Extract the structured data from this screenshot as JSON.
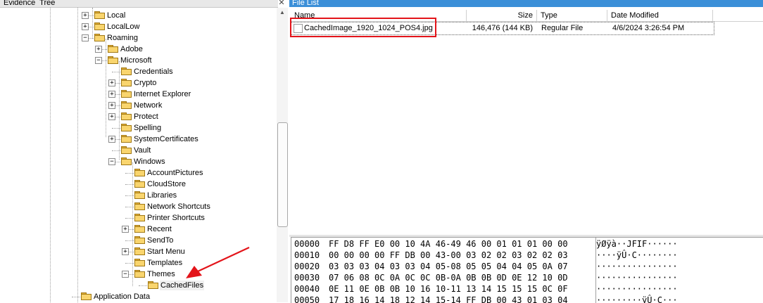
{
  "tree": {
    "title": "Evidence  Tree",
    "close_glyph": "✕",
    "rows": [
      {
        "label": "Local",
        "expander": "+"
      },
      {
        "label": "LocalLow",
        "expander": "+"
      },
      {
        "label": "Roaming",
        "expander": "−"
      },
      {
        "label": "Adobe",
        "expander": "+"
      },
      {
        "label": "Microsoft",
        "expander": "−"
      },
      {
        "label": "Credentials",
        "expander": ""
      },
      {
        "label": "Crypto",
        "expander": "+"
      },
      {
        "label": "Internet Explorer",
        "expander": "+"
      },
      {
        "label": "Network",
        "expander": "+"
      },
      {
        "label": "Protect",
        "expander": "+"
      },
      {
        "label": "Spelling",
        "expander": ""
      },
      {
        "label": "SystemCertificates",
        "expander": "+"
      },
      {
        "label": "Vault",
        "expander": ""
      },
      {
        "label": "Windows",
        "expander": "−"
      },
      {
        "label": "AccountPictures",
        "expander": ""
      },
      {
        "label": "CloudStore",
        "expander": ""
      },
      {
        "label": "Libraries",
        "expander": ""
      },
      {
        "label": "Network Shortcuts",
        "expander": ""
      },
      {
        "label": "Printer Shortcuts",
        "expander": ""
      },
      {
        "label": "Recent",
        "expander": "+"
      },
      {
        "label": "SendTo",
        "expander": ""
      },
      {
        "label": "Start Menu",
        "expander": "+"
      },
      {
        "label": "Templates",
        "expander": ""
      },
      {
        "label": "Themes",
        "expander": "−"
      },
      {
        "label": "CachedFiles",
        "expander": "",
        "selected": true
      },
      {
        "label": "Application Data",
        "expander": ""
      }
    ]
  },
  "file_list": {
    "title": "File List",
    "columns": {
      "name": "Name",
      "size": "Size",
      "type": "Type",
      "modified": "Date Modified"
    },
    "rows": [
      {
        "name": "CachedImage_1920_1024_POS4.jpg",
        "size": "146,476 (144 KB)",
        "type": "Regular File",
        "modified": "4/6/2024 3:26:54 PM"
      }
    ]
  },
  "hex": {
    "rows": [
      {
        "offset": "00000",
        "bytes": "FF D8 FF E0 00 10 4A 46-49 46 00 01 01 01 00 00",
        "ascii": "ÿØÿà··JFIF······"
      },
      {
        "offset": "00010",
        "bytes": "00 00 00 00 FF DB 00 43-00 03 02 02 03 02 02 03",
        "ascii": "····ÿÛ·C········"
      },
      {
        "offset": "00020",
        "bytes": "03 03 03 04 03 03 04 05-08 05 05 04 04 05 0A 07",
        "ascii": "················"
      },
      {
        "offset": "00030",
        "bytes": "07 06 08 0C 0A 0C 0C 0B-0A 0B 0B 0D 0E 12 10 0D",
        "ascii": "················"
      },
      {
        "offset": "00040",
        "bytes": "0E 11 0E 0B 0B 10 16 10-11 13 14 15 15 15 0C 0F",
        "ascii": "················"
      },
      {
        "offset": "00050",
        "bytes": "17 18 16 14 18 12 14 15-14 FF DB 00 43 01 03 04",
        "ascii": "·········ÿÛ·C···"
      }
    ]
  },
  "colors": {
    "annotation_red": "#e3141a",
    "title_bar_blue": "#3b8fd8",
    "folder_yellow": "#f9d56e"
  }
}
